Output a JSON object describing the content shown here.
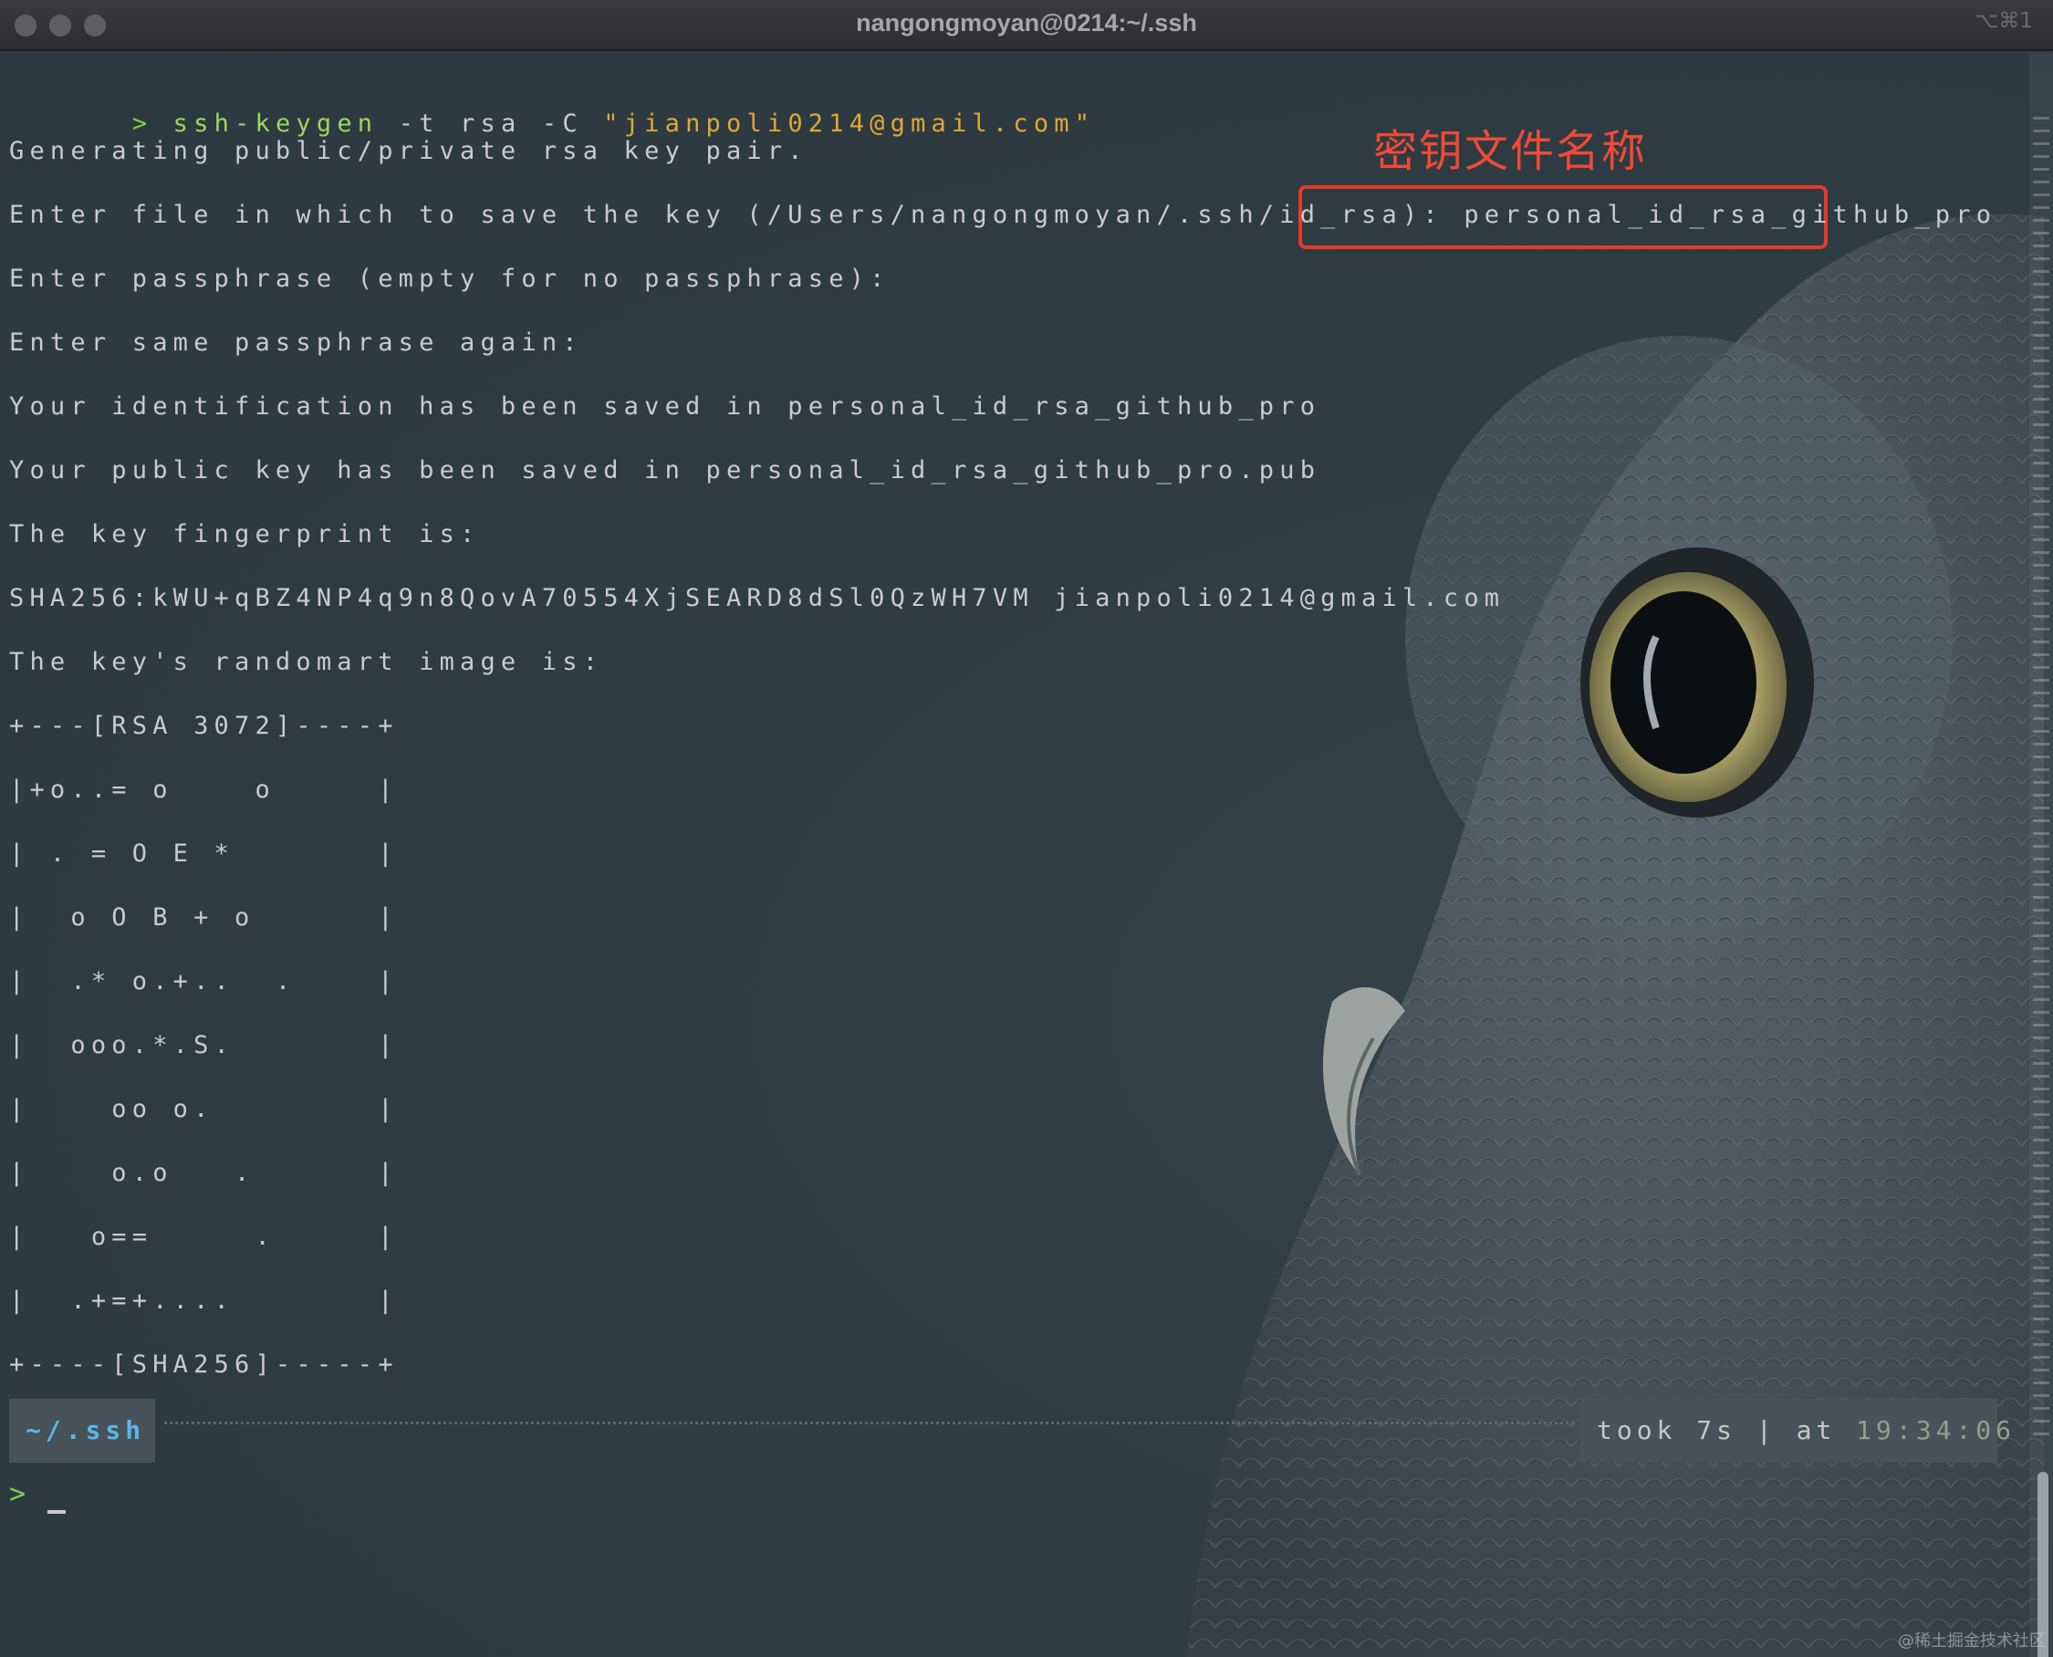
{
  "window": {
    "title": "nangongmoyan@0214:~/.ssh",
    "shortcut": "⌥⌘1"
  },
  "command": {
    "prompt_symbol": ">",
    "program": "ssh-keygen",
    "args": " -t rsa -C ",
    "email_arg": "\"jianpoli0214@gmail.com\""
  },
  "output_lines": [
    "Generating public/private rsa key pair.",
    "Enter file in which to save the key (/Users/nangongmoyan/.ssh/id_rsa): personal_id_rsa_github_pro",
    "Enter passphrase (empty for no passphrase):",
    "Enter same passphrase again:",
    "Your identification has been saved in personal_id_rsa_github_pro",
    "Your public key has been saved in personal_id_rsa_github_pro.pub",
    "The key fingerprint is:",
    "SHA256:kWU+qBZ4NP4q9n8QovA70554XjSEARD8dSl0QzWH7VM jianpoli0214@gmail.com",
    "The key's randomart image is:",
    "+---[RSA 3072]----+",
    "|+o..= o    o     |",
    "| . = O E *       |",
    "|  o O B + o      |",
    "|  .* o.+..  .    |",
    "|  ooo.*.S.       |",
    "|    oo o.        |",
    "|    o.o   .      |",
    "|   o==     .     |",
    "|  .+=+....       |",
    "+----[SHA256]-----+"
  ],
  "annotation": {
    "label": "密钥文件名称",
    "color": "#e8392a"
  },
  "status": {
    "directory": "~/.ssh",
    "took_label": "took 7s | at ",
    "time": "19:34:06"
  },
  "input_prompt": ">",
  "watermark": "@稀土掘金技术社区",
  "colors": {
    "background": "#2f3d45",
    "prompt_green": "#7fd04a",
    "string_yellow": "#e0a830",
    "dir_blue": "#59b8ec",
    "text": "#c7ccd0"
  }
}
